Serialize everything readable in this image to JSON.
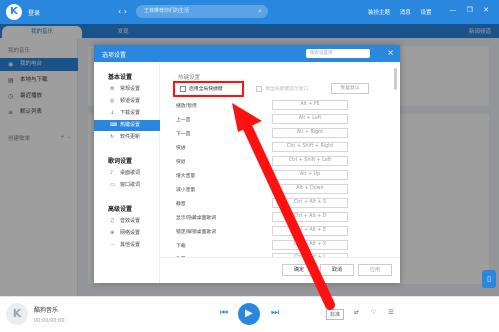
{
  "topbar": {
    "login": "登录",
    "search_placeholder": "王菲推荐你们的生活",
    "links": [
      "装扮主题",
      "消息",
      "设置"
    ],
    "window_controls": "— ❐ ✕"
  },
  "tabs": [
    {
      "label": "我的音乐",
      "active": true
    },
    {
      "label": "发现",
      "active": false
    }
  ],
  "share_label": "新闻频道",
  "sidebar": {
    "section_mine": "我的音乐",
    "items": [
      {
        "label": "我的电台",
        "icon": "radio-icon",
        "active": true
      },
      {
        "label": "本地与下载",
        "icon": "download-icon",
        "active": false
      },
      {
        "label": "最近播放",
        "icon": "clock-icon",
        "active": false
      },
      {
        "label": "默认列表",
        "icon": "list-icon",
        "active": false
      }
    ],
    "section_created": "创建歌单"
  },
  "dialog": {
    "title": "选项设置",
    "search_placeholder": "搜索设置项",
    "categories": [
      {
        "title": "基本设置",
        "items": [
          {
            "label": "常规设置",
            "icon": "gear-icon"
          },
          {
            "label": "频道设置",
            "icon": "channel-icon"
          },
          {
            "label": "下载设置",
            "icon": "download-icon"
          },
          {
            "label": "热键设置",
            "icon": "keyboard-icon",
            "active": true
          },
          {
            "label": "软件更新",
            "icon": "update-icon"
          }
        ]
      },
      {
        "title": "歌词设置",
        "items": [
          {
            "label": "桌面歌词",
            "icon": "lyric-icon"
          },
          {
            "label": "窗口歌词",
            "icon": "window-icon"
          }
        ]
      },
      {
        "title": "高级设置",
        "items": [
          {
            "label": "音效设置",
            "icon": "equalizer-icon"
          },
          {
            "label": "网络设置",
            "icon": "network-icon"
          },
          {
            "label": "其他设置",
            "icon": "more-icon"
          }
        ]
      }
    ],
    "hotkeys": {
      "section_title": "热键设置",
      "enable_global": "启用全局快捷键",
      "conflict_option": "弹出快捷键提示窗口",
      "restore_default": "恢复默认",
      "rows": [
        {
          "label": "播放/暂停",
          "key": "Alt + F5"
        },
        {
          "label": "上一首",
          "key": "Alt + Left"
        },
        {
          "label": "下一首",
          "key": "Alt + Right"
        },
        {
          "label": "快进",
          "key": "Ctrl + Shift + Right"
        },
        {
          "label": "快退",
          "key": "Ctrl + Shift + Left"
        },
        {
          "label": "增大音量",
          "key": "Alt + Up"
        },
        {
          "label": "减小音量",
          "key": "Alt + Down"
        },
        {
          "label": "静音",
          "key": "Ctrl + Alt + S"
        },
        {
          "label": "显示/隐藏桌面歌词",
          "key": "Ctrl + Alt + D"
        },
        {
          "label": "锁定/解锁桌面歌词",
          "key": "Ctrl + Alt + E"
        },
        {
          "label": "下载",
          "key": "Ctrl + Alt + X"
        },
        {
          "label": "收藏",
          "key": "Ctrl + Alt + L"
        }
      ]
    },
    "buttons": {
      "ok": "确定",
      "cancel": "取消",
      "apply": "应用"
    }
  },
  "player": {
    "title": "酷狗音乐",
    "time": "00:00/00:00",
    "quality": "标准"
  },
  "colors": {
    "accent": "#2a87de",
    "highlight": "#ff1111"
  }
}
